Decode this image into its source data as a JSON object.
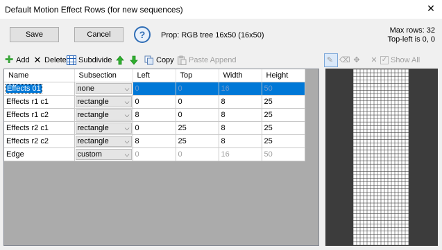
{
  "window": {
    "title": "Default Motion Effect Rows (for new sequences)",
    "close_glyph": "✕"
  },
  "actions": {
    "save": "Save",
    "cancel": "Cancel",
    "help": "?"
  },
  "prop": "Prop: RGB tree 16x50 (16x50)",
  "info": {
    "max_rows": "Max rows: 32",
    "top_left": "Top-left is 0, 0"
  },
  "toolbar": {
    "add": "Add",
    "delete": "Delete",
    "subdivide": "Subdivide",
    "copy": "Copy",
    "paste_append": "Paste Append",
    "show_all": "Show All"
  },
  "grid": {
    "columns": [
      "Name",
      "Subsection",
      "Left",
      "Top",
      "Width",
      "Height"
    ],
    "rows": [
      {
        "name": "Effects 01",
        "subsection": "none",
        "left": "0",
        "top": "0",
        "width": "16",
        "height": "50"
      },
      {
        "name": "Effects r1 c1",
        "subsection": "rectangle",
        "left": "0",
        "top": "0",
        "width": "8",
        "height": "25"
      },
      {
        "name": "Effects r1 c2",
        "subsection": "rectangle",
        "left": "8",
        "top": "0",
        "width": "8",
        "height": "25"
      },
      {
        "name": "Effects r2 c1",
        "subsection": "rectangle",
        "left": "0",
        "top": "25",
        "width": "8",
        "height": "25"
      },
      {
        "name": "Effects r2 c2",
        "subsection": "rectangle",
        "left": "8",
        "top": "25",
        "width": "8",
        "height": "25"
      },
      {
        "name": "Edge",
        "subsection": "custom",
        "left": "0",
        "top": "0",
        "width": "16",
        "height": "50"
      }
    ]
  },
  "colors": {
    "selection": "#0078d7",
    "add_icon": "#3aa53a",
    "arrow_icon": "#2fb02f",
    "preview_bg": "#3c3c3c"
  }
}
